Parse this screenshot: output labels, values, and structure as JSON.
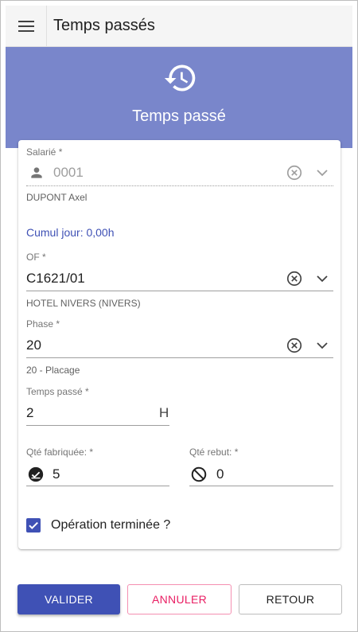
{
  "appbar": {
    "title": "Temps passés",
    "menu_icon": "menu-icon"
  },
  "hero": {
    "icon": "history-icon",
    "title": "Temps passé"
  },
  "form": {
    "salarie": {
      "label": "Salarié *",
      "value": "0001",
      "hint": "DUPONT Axel"
    },
    "cumul": "Cumul jour: 0,00h",
    "of": {
      "label": "OF *",
      "value": "C1621/01",
      "hint": "HOTEL NIVERS (NIVERS)"
    },
    "phase": {
      "label": "Phase *",
      "value": "20",
      "hint": "20 - Placage"
    },
    "temps": {
      "label": "Temps passé *",
      "value": "2",
      "unit": "H"
    },
    "qte_fab": {
      "label": "Qté fabriquée: *",
      "value": "5"
    },
    "qte_rebut": {
      "label": "Qté rebut: *",
      "value": "0"
    },
    "operation": {
      "label": "Opération terminée ?",
      "checked": true
    }
  },
  "buttons": {
    "valider": "VALIDER",
    "annuler": "ANNULER",
    "retour": "RETOUR"
  },
  "colors": {
    "primary": "#3f51b5",
    "hero": "#7986cb",
    "accent": "#e91e63",
    "link": "#3f51b5"
  }
}
